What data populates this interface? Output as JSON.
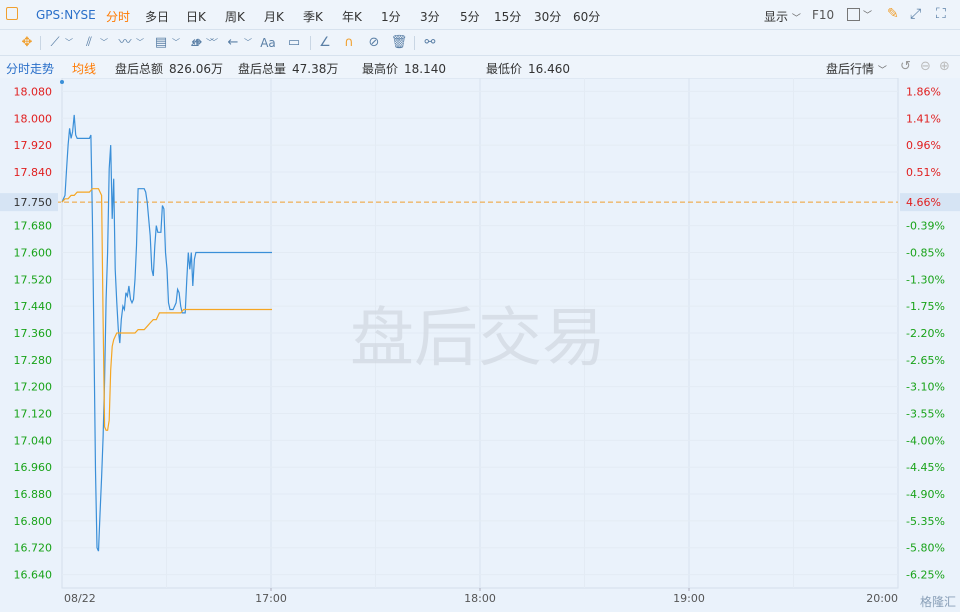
{
  "header": {
    "symbol": "GPS:NYSE",
    "tabs": [
      "分时",
      "多日",
      "日K",
      "周K",
      "月K",
      "季K",
      "年K",
      "1分",
      "3分",
      "5分",
      "15分",
      "30分",
      "60分"
    ],
    "active_tab": "分时",
    "display_label": "显示",
    "f10_label": "F10"
  },
  "toolbar": {
    "text_tool_label": "Aa"
  },
  "info": {
    "mode_label": "分时走势",
    "avg_label": "均线",
    "amount_label": "盘后总额",
    "amount_value": "826.06万",
    "volume_label": "盘后总量",
    "volume_value": "47.38万",
    "high_label": "最高价",
    "high_value": "18.140",
    "low_label": "最低价",
    "low_value": "16.460",
    "quote_label": "盘后行情"
  },
  "watermark": "盘后交易",
  "brand": "格隆汇",
  "colors": {
    "price_line": "#3a8fd8",
    "avg_line": "#f5a623",
    "up": "#e02020",
    "down": "#19a319",
    "ref_line": "#f0a030",
    "accent": "#ff7a00"
  },
  "chart_data": {
    "type": "line",
    "ylim": [
      16.6,
      18.12
    ],
    "reference_price": 17.75,
    "reference_pct": "4.66%",
    "y_ticks": [
      "18.080",
      "18.000",
      "17.920",
      "17.840",
      "17.750",
      "17.680",
      "17.600",
      "17.520",
      "17.440",
      "17.360",
      "17.280",
      "17.200",
      "17.120",
      "17.040",
      "16.960",
      "16.880",
      "16.800",
      "16.720",
      "16.640"
    ],
    "pct_ticks": [
      "1.86%",
      "1.41%",
      "0.96%",
      "0.51%",
      "4.66%",
      "-0.39%",
      "-0.85%",
      "-1.30%",
      "-1.75%",
      "-2.20%",
      "-2.65%",
      "-3.10%",
      "-3.55%",
      "-4.00%",
      "-4.45%",
      "-4.90%",
      "-5.35%",
      "-5.80%",
      "-6.25%"
    ],
    "x_labels": [
      "08/22",
      "17:00",
      "18:00",
      "19:00",
      "20:00"
    ],
    "series": [
      {
        "x": [
          0,
          2,
          4,
          6,
          8,
          10,
          12,
          14,
          16,
          18,
          20,
          22,
          24,
          26,
          28,
          30,
          32,
          34,
          36,
          38,
          40,
          42,
          44,
          46,
          48,
          50,
          52,
          54,
          56,
          58,
          60,
          62,
          64,
          66,
          68,
          70,
          72,
          74,
          76,
          78,
          80,
          82,
          84,
          86,
          88,
          90,
          92,
          94,
          96,
          98,
          100,
          102,
          104,
          106,
          108,
          110,
          112,
          114,
          116,
          118,
          120,
          122,
          124,
          126,
          128,
          130,
          132,
          134,
          136,
          138,
          140,
          142,
          144,
          146,
          148,
          150,
          152,
          154,
          156,
          158,
          160,
          162,
          164,
          166,
          168,
          170,
          172,
          174,
          176,
          178,
          180,
          182,
          184,
          186,
          188,
          190,
          192,
          194,
          196,
          198,
          200,
          202,
          204,
          206,
          208,
          210,
          212,
          214,
          216,
          218,
          220,
          222,
          224,
          226,
          228,
          230,
          232,
          234,
          236,
          238,
          240,
          242,
          244,
          246,
          248,
          250,
          252,
          254,
          256,
          258,
          260,
          262,
          264,
          266,
          268,
          270,
          272,
          274,
          276
        ],
        "values": [
          17.75,
          17.76,
          17.77,
          17.85,
          17.92,
          17.97,
          17.94,
          17.96,
          18.01,
          17.95,
          17.94,
          17.94,
          17.94,
          17.94,
          17.94,
          17.94,
          17.94,
          17.94,
          17.94,
          17.95,
          17.7,
          17.35,
          16.95,
          16.72,
          16.71,
          16.82,
          16.93,
          17.05,
          17.22,
          17.46,
          17.6,
          17.85,
          17.92,
          17.7,
          17.82,
          17.55,
          17.45,
          17.37,
          17.33,
          17.4,
          17.44,
          17.43,
          17.48,
          17.47,
          17.5,
          17.46,
          17.45,
          17.46,
          17.52,
          17.62,
          17.79,
          17.79,
          17.79,
          17.79,
          17.79,
          17.78,
          17.75,
          17.7,
          17.65,
          17.55,
          17.53,
          17.62,
          17.68,
          17.66,
          17.66,
          17.66,
          17.74,
          17.73,
          17.6,
          17.55,
          17.45,
          17.43,
          17.43,
          17.43,
          17.44,
          17.45,
          17.49,
          17.48,
          17.44,
          17.42,
          17.42,
          17.42,
          17.52,
          17.6,
          17.55,
          17.6,
          17.5,
          17.58,
          17.6,
          17.6,
          17.6,
          17.6,
          17.6,
          17.6,
          17.6,
          17.6,
          17.6,
          17.6,
          17.6,
          17.6,
          17.6,
          17.6,
          17.6,
          17.6,
          17.6,
          17.6,
          17.6,
          17.6,
          17.6,
          17.6,
          17.6,
          17.6,
          17.6,
          17.6,
          17.6,
          17.6,
          17.6,
          17.6,
          17.6,
          17.6,
          17.6,
          17.6,
          17.6,
          17.6,
          17.6,
          17.6,
          17.6,
          17.6,
          17.6,
          17.6,
          17.6,
          17.6,
          17.6,
          17.6,
          17.6,
          17.6,
          17.6,
          17.6,
          17.6
        ]
      },
      {
        "x": [
          0,
          4,
          8,
          12,
          16,
          20,
          24,
          28,
          32,
          36,
          40,
          44,
          48,
          52,
          54,
          56,
          58,
          60,
          62,
          64,
          66,
          68,
          70,
          72,
          74,
          76,
          80,
          84,
          88,
          92,
          96,
          100,
          104,
          108,
          112,
          116,
          120,
          124,
          128,
          132,
          136,
          140,
          144,
          148,
          152,
          156,
          160,
          164,
          168,
          172,
          176,
          180,
          184,
          188,
          192,
          196,
          200,
          204,
          208,
          212,
          216,
          220,
          224,
          228,
          232,
          236,
          240,
          244,
          248,
          252,
          256,
          260,
          264,
          268,
          272,
          276
        ],
        "values": [
          17.75,
          17.76,
          17.76,
          17.77,
          17.77,
          17.78,
          17.78,
          17.78,
          17.78,
          17.78,
          17.79,
          17.79,
          17.79,
          17.77,
          17.4,
          17.08,
          17.07,
          17.07,
          17.1,
          17.25,
          17.32,
          17.34,
          17.35,
          17.36,
          17.36,
          17.36,
          17.36,
          17.36,
          17.36,
          17.36,
          17.36,
          17.37,
          17.37,
          17.37,
          17.38,
          17.39,
          17.4,
          17.4,
          17.42,
          17.42,
          17.42,
          17.42,
          17.42,
          17.42,
          17.42,
          17.42,
          17.43,
          17.43,
          17.43,
          17.43,
          17.43,
          17.43,
          17.43,
          17.43,
          17.43,
          17.43,
          17.43,
          17.43,
          17.43,
          17.43,
          17.43,
          17.43,
          17.43,
          17.43,
          17.43,
          17.43,
          17.43,
          17.43,
          17.43,
          17.43,
          17.43,
          17.43,
          17.43,
          17.43,
          17.43,
          17.43
        ]
      }
    ]
  }
}
